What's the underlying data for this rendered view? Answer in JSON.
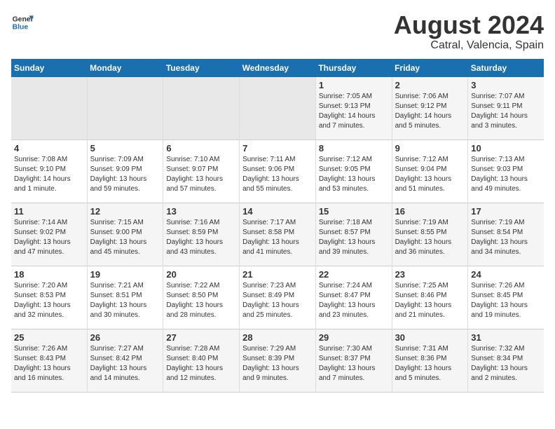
{
  "header": {
    "logo_general": "General",
    "logo_blue": "Blue",
    "title": "August 2024",
    "subtitle": "Catral, Valencia, Spain"
  },
  "days_of_week": [
    "Sunday",
    "Monday",
    "Tuesday",
    "Wednesday",
    "Thursday",
    "Friday",
    "Saturday"
  ],
  "weeks": [
    {
      "days": [
        {
          "num": "",
          "info": ""
        },
        {
          "num": "",
          "info": ""
        },
        {
          "num": "",
          "info": ""
        },
        {
          "num": "",
          "info": ""
        },
        {
          "num": "1",
          "info": "Sunrise: 7:05 AM\nSunset: 9:13 PM\nDaylight: 14 hours\nand 7 minutes."
        },
        {
          "num": "2",
          "info": "Sunrise: 7:06 AM\nSunset: 9:12 PM\nDaylight: 14 hours\nand 5 minutes."
        },
        {
          "num": "3",
          "info": "Sunrise: 7:07 AM\nSunset: 9:11 PM\nDaylight: 14 hours\nand 3 minutes."
        }
      ]
    },
    {
      "days": [
        {
          "num": "4",
          "info": "Sunrise: 7:08 AM\nSunset: 9:10 PM\nDaylight: 14 hours\nand 1 minute."
        },
        {
          "num": "5",
          "info": "Sunrise: 7:09 AM\nSunset: 9:09 PM\nDaylight: 13 hours\nand 59 minutes."
        },
        {
          "num": "6",
          "info": "Sunrise: 7:10 AM\nSunset: 9:07 PM\nDaylight: 13 hours\nand 57 minutes."
        },
        {
          "num": "7",
          "info": "Sunrise: 7:11 AM\nSunset: 9:06 PM\nDaylight: 13 hours\nand 55 minutes."
        },
        {
          "num": "8",
          "info": "Sunrise: 7:12 AM\nSunset: 9:05 PM\nDaylight: 13 hours\nand 53 minutes."
        },
        {
          "num": "9",
          "info": "Sunrise: 7:12 AM\nSunset: 9:04 PM\nDaylight: 13 hours\nand 51 minutes."
        },
        {
          "num": "10",
          "info": "Sunrise: 7:13 AM\nSunset: 9:03 PM\nDaylight: 13 hours\nand 49 minutes."
        }
      ]
    },
    {
      "days": [
        {
          "num": "11",
          "info": "Sunrise: 7:14 AM\nSunset: 9:02 PM\nDaylight: 13 hours\nand 47 minutes."
        },
        {
          "num": "12",
          "info": "Sunrise: 7:15 AM\nSunset: 9:00 PM\nDaylight: 13 hours\nand 45 minutes."
        },
        {
          "num": "13",
          "info": "Sunrise: 7:16 AM\nSunset: 8:59 PM\nDaylight: 13 hours\nand 43 minutes."
        },
        {
          "num": "14",
          "info": "Sunrise: 7:17 AM\nSunset: 8:58 PM\nDaylight: 13 hours\nand 41 minutes."
        },
        {
          "num": "15",
          "info": "Sunrise: 7:18 AM\nSunset: 8:57 PM\nDaylight: 13 hours\nand 39 minutes."
        },
        {
          "num": "16",
          "info": "Sunrise: 7:19 AM\nSunset: 8:55 PM\nDaylight: 13 hours\nand 36 minutes."
        },
        {
          "num": "17",
          "info": "Sunrise: 7:19 AM\nSunset: 8:54 PM\nDaylight: 13 hours\nand 34 minutes."
        }
      ]
    },
    {
      "days": [
        {
          "num": "18",
          "info": "Sunrise: 7:20 AM\nSunset: 8:53 PM\nDaylight: 13 hours\nand 32 minutes."
        },
        {
          "num": "19",
          "info": "Sunrise: 7:21 AM\nSunset: 8:51 PM\nDaylight: 13 hours\nand 30 minutes."
        },
        {
          "num": "20",
          "info": "Sunrise: 7:22 AM\nSunset: 8:50 PM\nDaylight: 13 hours\nand 28 minutes."
        },
        {
          "num": "21",
          "info": "Sunrise: 7:23 AM\nSunset: 8:49 PM\nDaylight: 13 hours\nand 25 minutes."
        },
        {
          "num": "22",
          "info": "Sunrise: 7:24 AM\nSunset: 8:47 PM\nDaylight: 13 hours\nand 23 minutes."
        },
        {
          "num": "23",
          "info": "Sunrise: 7:25 AM\nSunset: 8:46 PM\nDaylight: 13 hours\nand 21 minutes."
        },
        {
          "num": "24",
          "info": "Sunrise: 7:26 AM\nSunset: 8:45 PM\nDaylight: 13 hours\nand 19 minutes."
        }
      ]
    },
    {
      "days": [
        {
          "num": "25",
          "info": "Sunrise: 7:26 AM\nSunset: 8:43 PM\nDaylight: 13 hours\nand 16 minutes."
        },
        {
          "num": "26",
          "info": "Sunrise: 7:27 AM\nSunset: 8:42 PM\nDaylight: 13 hours\nand 14 minutes."
        },
        {
          "num": "27",
          "info": "Sunrise: 7:28 AM\nSunset: 8:40 PM\nDaylight: 13 hours\nand 12 minutes."
        },
        {
          "num": "28",
          "info": "Sunrise: 7:29 AM\nSunset: 8:39 PM\nDaylight: 13 hours\nand 9 minutes."
        },
        {
          "num": "29",
          "info": "Sunrise: 7:30 AM\nSunset: 8:37 PM\nDaylight: 13 hours\nand 7 minutes."
        },
        {
          "num": "30",
          "info": "Sunrise: 7:31 AM\nSunset: 8:36 PM\nDaylight: 13 hours\nand 5 minutes."
        },
        {
          "num": "31",
          "info": "Sunrise: 7:32 AM\nSunset: 8:34 PM\nDaylight: 13 hours\nand 2 minutes."
        }
      ]
    }
  ]
}
